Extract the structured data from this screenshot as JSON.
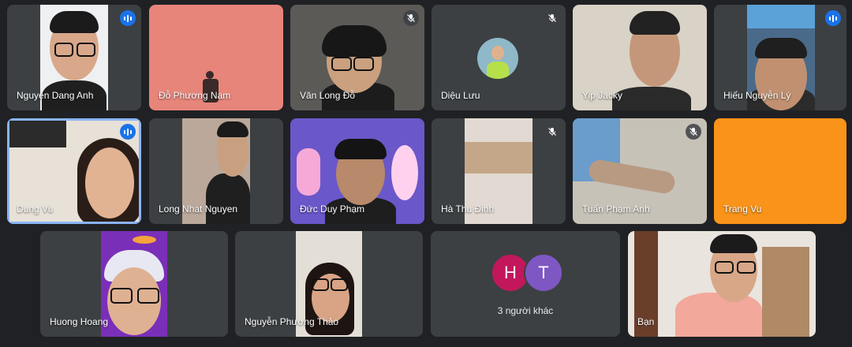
{
  "participants": [
    {
      "name": "Nguyen Dang Anh",
      "status": "speaking"
    },
    {
      "name": "Đỗ Phương Nam",
      "status": "none"
    },
    {
      "name": "Văn Long Đỗ",
      "status": "muted"
    },
    {
      "name": "Diệu Lưu",
      "status": "muted"
    },
    {
      "name": "Yip Jacky",
      "status": "none"
    },
    {
      "name": "Hiếu Nguyễn Lý",
      "status": "speaking"
    },
    {
      "name": "Dung Vu",
      "status": "speaking"
    },
    {
      "name": "Long Nhat Nguyen",
      "status": "none"
    },
    {
      "name": "Đức Duy Phạm",
      "status": "none"
    },
    {
      "name": "Hà Thu Đinh",
      "status": "muted"
    },
    {
      "name": "Tuấn Phạm Anh",
      "status": "muted"
    },
    {
      "name": "Trang Vu",
      "status": "none"
    },
    {
      "name": "Huong Hoang",
      "status": "none"
    },
    {
      "name": "Nguyễn Phương Thảo",
      "status": "none"
    },
    {
      "name": "Bạn",
      "status": "none"
    }
  ],
  "others": {
    "label": "3 người khác",
    "initials": [
      "H",
      "T"
    ],
    "colors": [
      "#c2185b",
      "#7e57c2"
    ]
  },
  "colors": {
    "background": "#202124",
    "tile": "#3c4043",
    "speaking_blue": "#1a73e8",
    "active_outline": "#8ab4f8",
    "trang_vu_tile": "#fa9319",
    "do_phuong_nam_bg": "#e8857a"
  }
}
